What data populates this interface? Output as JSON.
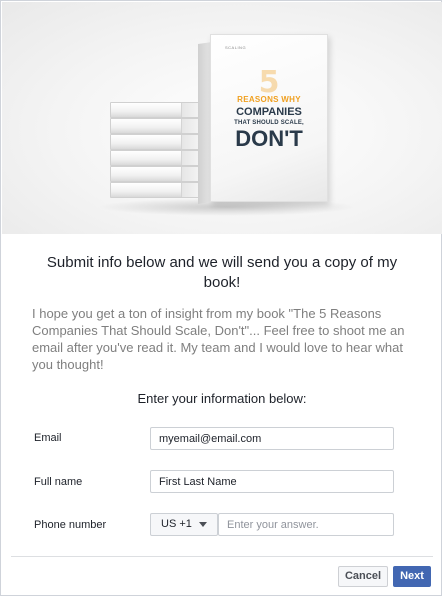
{
  "hero": {
    "book_cover": {
      "brand": "SCALING",
      "number": "5",
      "line1": "REASONS WHY",
      "line2": "COMPANIES",
      "line3": "THAT SHOULD SCALE,",
      "line4": "DON'T",
      "accent_color": "#f0a020",
      "title_color": "#2a3a4a"
    }
  },
  "headline": "Submit info below and we will send you a copy of my book!",
  "description": "I hope you get a ton of insight from my book \"The 5 Reasons Companies That Should Scale, Don't\"... Feel free to shoot me an email after you've read it. My team and I would love to hear what you thought!",
  "form": {
    "intro": "Enter your information below:",
    "email": {
      "label": "Email",
      "value": "myemail@email.com"
    },
    "full_name": {
      "label": "Full name",
      "value": "First Last Name"
    },
    "phone": {
      "label": "Phone number",
      "country_code": "US +1",
      "placeholder": "Enter your answer."
    }
  },
  "footer": {
    "cancel_label": "Cancel",
    "next_label": "Next",
    "next_color": "#4267b2"
  }
}
